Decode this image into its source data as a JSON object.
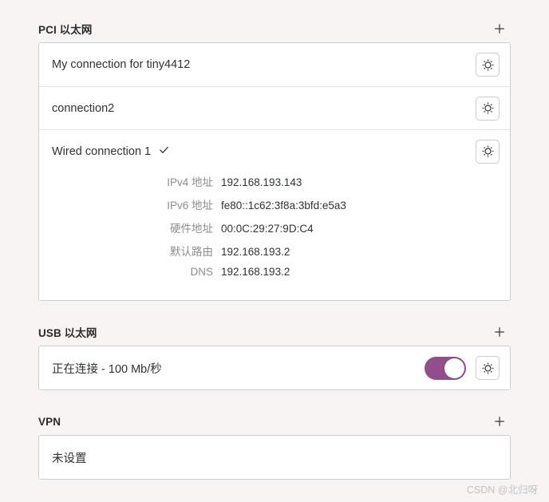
{
  "sections": [
    {
      "title": "PCI 以太网",
      "add_icon": "plus-icon",
      "connections": [
        {
          "name": "My connection for tiny4412",
          "active": false,
          "settings_icon": "gear-icon"
        },
        {
          "name": "connection2",
          "active": false,
          "settings_icon": "gear-icon"
        },
        {
          "name": "Wired connection 1",
          "active": true,
          "check_icon": "check-icon",
          "settings_icon": "gear-icon"
        }
      ],
      "details": [
        {
          "key": "IPv4 地址",
          "value": "192.168.193.143"
        },
        {
          "key": "IPv6 地址",
          "value": "fe80::1c62:3f8a:3bfd:e5a3"
        },
        {
          "key": "硬件地址",
          "value": "00:0C:29:27:9D:C4"
        },
        {
          "key": "默认路由",
          "value": "192.168.193.2"
        },
        {
          "key": "DNS",
          "value": "192.168.193.2"
        }
      ]
    },
    {
      "title": "USB 以太网",
      "add_icon": "plus-icon",
      "status": "正在连接 - 100 Mb/秒",
      "toggle_on": true,
      "settings_icon": "gear-icon"
    },
    {
      "title": "VPN",
      "add_icon": "plus-icon",
      "empty_label": "未设置"
    }
  ],
  "watermark": "CSDN @北归呀",
  "colors": {
    "page_background": "#f6f5f4",
    "card_background": "#ffffff",
    "card_border": "#cfcecb",
    "row_divider": "#e6e4e1",
    "text_primary": "#2e3436",
    "text_muted": "#8b8e8f",
    "toggle_on": "#924d8c",
    "toggle_knob": "#ffffff",
    "watermark": "#c2c2c2"
  }
}
